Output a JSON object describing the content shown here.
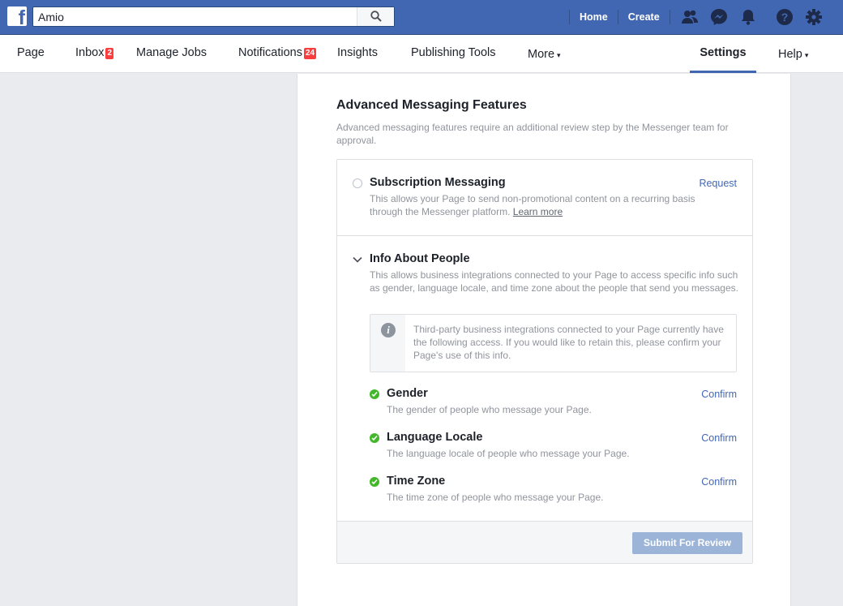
{
  "topbar": {
    "logo": "f",
    "search_value": "Amio",
    "search_icon": "search-icon",
    "links": [
      "Home",
      "Create"
    ],
    "icons": [
      "friends-icon",
      "messenger-icon",
      "notifications-bell-icon",
      "help-icon",
      "gear-icon"
    ],
    "brand_color": "#4267b2"
  },
  "subnav": {
    "items": [
      {
        "label": "Page"
      },
      {
        "label": "Inbox",
        "badge": "2"
      },
      {
        "label": "Manage Jobs"
      },
      {
        "label": "Notifications",
        "badge": "24"
      },
      {
        "label": "Insights"
      },
      {
        "label": "Publishing Tools"
      },
      {
        "label": "More",
        "caret": "▾"
      },
      {
        "label": "Settings",
        "active": true
      },
      {
        "label": "Help",
        "caret": "▾"
      }
    ]
  },
  "main": {
    "title": "Advanced Messaging Features",
    "description": "Advanced messaging features require an additional review step by the Messenger team for approval.",
    "subscription": {
      "title": "Subscription Messaging",
      "description": "This allows your Page to send non-promotional content on a recurring basis through the Messenger platform.",
      "learn_more": "Learn more",
      "action": "Request"
    },
    "info_about_people": {
      "title": "Info About People",
      "description": "This allows business integrations connected to your Page to access specific info such as gender, language locale, and time zone about the people that send you messages.",
      "notice": "Third-party business integrations connected to your Page currently have the following access. If you would like to retain this, please confirm your Page's use of this info.",
      "items": [
        {
          "title": "Gender",
          "description": "The gender of people who message your Page.",
          "action": "Confirm"
        },
        {
          "title": "Language Locale",
          "description": "The language locale of people who message your Page.",
          "action": "Confirm"
        },
        {
          "title": "Time Zone",
          "description": "The time zone of people who message your Page.",
          "action": "Confirm"
        }
      ]
    },
    "submit_label": "Submit For Review"
  }
}
